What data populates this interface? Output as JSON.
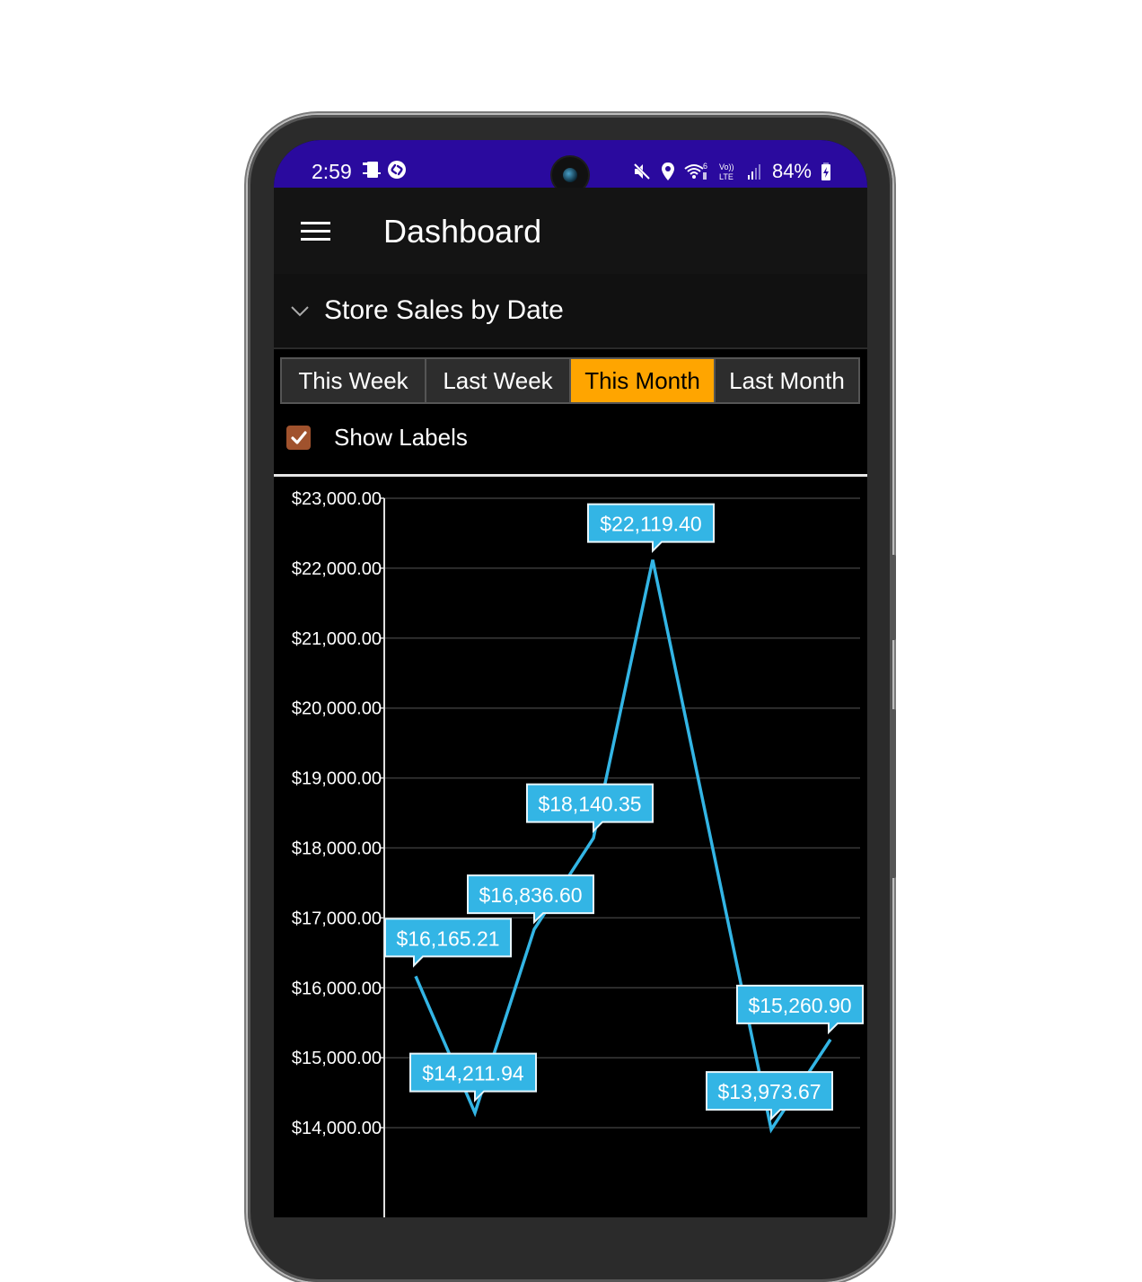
{
  "status_bar": {
    "time": "2:59",
    "left_icons": [
      "screen-mirror-icon",
      "shazam-icon"
    ],
    "right_icons": [
      "mute-icon",
      "location-icon",
      "wifi-6-icon",
      "volte-icon",
      "signal-icon"
    ],
    "battery": "84%",
    "background": "#2a0a9e"
  },
  "app_bar": {
    "title": "Dashboard",
    "menu_icon": "hamburger-menu-icon"
  },
  "section": {
    "title": "Store Sales by Date",
    "expanded": true
  },
  "tabs": [
    {
      "label": "This Week",
      "active": false
    },
    {
      "label": "Last Week",
      "active": false
    },
    {
      "label": "This Month",
      "active": true
    },
    {
      "label": "Last Month",
      "active": false
    }
  ],
  "accent_color": "#ffa500",
  "show_labels": {
    "label": "Show Labels",
    "checked": true,
    "color": "#a0522d"
  },
  "chart_data": {
    "type": "line",
    "title": "",
    "xlabel": "",
    "ylabel": "",
    "ylim": [
      13750,
      23000
    ],
    "y_ticks": [
      {
        "value": 23000,
        "label": "$23,000.00"
      },
      {
        "value": 22000,
        "label": "$22,000.00"
      },
      {
        "value": 21000,
        "label": "$21,000.00"
      },
      {
        "value": 20000,
        "label": "$20,000.00"
      },
      {
        "value": 19000,
        "label": "$19,000.00"
      },
      {
        "value": 18000,
        "label": "$18,000.00"
      },
      {
        "value": 17000,
        "label": "$17,000.00"
      },
      {
        "value": 16000,
        "label": "$16,000.00"
      },
      {
        "value": 15000,
        "label": "$15,000.00"
      },
      {
        "value": 14000,
        "label": "$14,000.00"
      }
    ],
    "grid": true,
    "line_color": "#33b5e5",
    "series": [
      {
        "name": "Store Sales",
        "x": [
          1,
          2,
          3,
          4,
          5,
          7,
          8
        ],
        "values": [
          16165.21,
          14211.94,
          16836.6,
          18140.35,
          22119.4,
          13973.67,
          15260.9
        ],
        "labels": [
          "$16,165.21",
          "$14,211.94",
          "$16,836.60",
          "$18,140.35",
          "$22,119.40",
          "$13,973.67",
          "$15,260.90"
        ]
      }
    ]
  }
}
